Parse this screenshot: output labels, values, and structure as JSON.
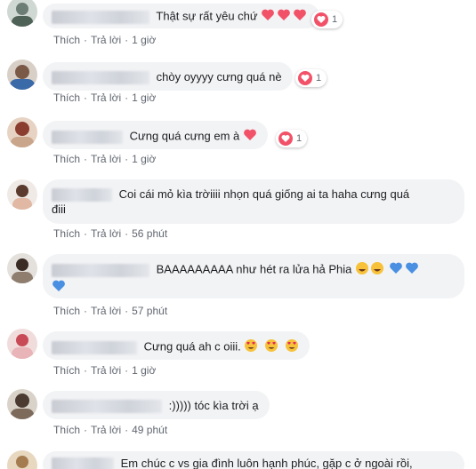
{
  "actions": {
    "like": "Thích",
    "reply": "Trả lời"
  },
  "comments": [
    {
      "text": "Thật sự rất yêu chứ",
      "time": "1 giờ",
      "reactions": "1"
    },
    {
      "text": "chòy oyyyy cưng quá nè",
      "time": "1 giờ",
      "reactions": "1"
    },
    {
      "text": "Cưng quá cưng em à",
      "time": "1 giờ",
      "reactions": "1"
    },
    {
      "text_line1": "Coi cái mỏ kìa trờiiii nhọn quá giống ai ta haha cưng quá",
      "text_line2": "điii",
      "time": "56 phút"
    },
    {
      "text": "BAAAAAAAAA như hét ra lửa hả Phia",
      "time": "57 phút"
    },
    {
      "text": "Cưng quá ah c oiii.",
      "time": "1 giờ"
    },
    {
      "text": ":))))) tóc kìa trời ạ",
      "time": "49 phút"
    },
    {
      "text": "Em chúc c vs gia đình luôn hạnh phúc, gặp c ở ngoài rồi,"
    }
  ],
  "colors": {
    "bubble": "#f2f3f5",
    "heart": "#f25268",
    "blue_heart": "#4a90e2",
    "emoji_yellow": "#f7c23a"
  }
}
